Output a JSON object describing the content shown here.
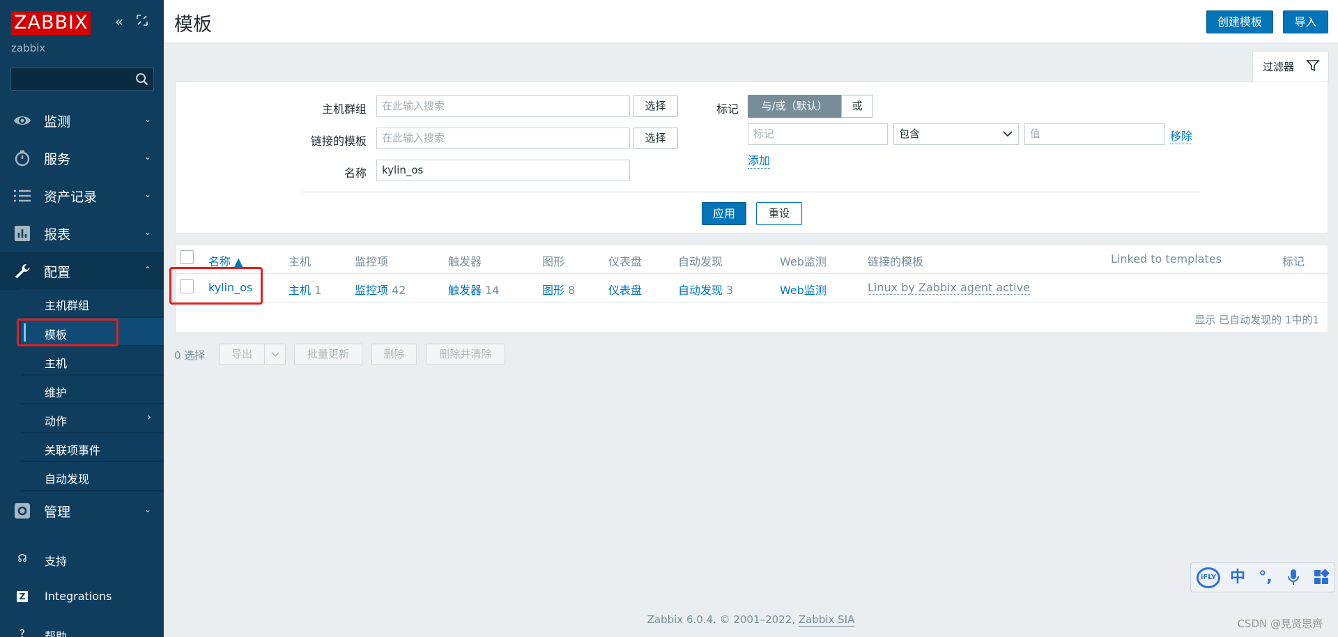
{
  "sidebar": {
    "logo": "ZABBIX",
    "server": "zabbix",
    "collapse_icon": "double-chevron-left-icon",
    "expand_icon": "kiosk-mode-icon",
    "search_placeholder": "",
    "menu": [
      {
        "label": "监测",
        "icon": "eye-icon"
      },
      {
        "label": "服务",
        "icon": "stopwatch-icon"
      },
      {
        "label": "资产记录",
        "icon": "list-icon"
      },
      {
        "label": "报表",
        "icon": "bar-chart-icon"
      },
      {
        "label": "配置",
        "icon": "wrench-icon"
      }
    ],
    "submenu": [
      {
        "label": "主机群组"
      },
      {
        "label": "模板"
      },
      {
        "label": "主机"
      },
      {
        "label": "维护"
      },
      {
        "label": "动作"
      },
      {
        "label": "关联项事件"
      },
      {
        "label": "自动发现"
      }
    ],
    "admin": {
      "label": "管理",
      "icon": "gear-icon"
    },
    "bottom": [
      {
        "label": "支持",
        "icon": "headset-icon"
      },
      {
        "label": "Integrations",
        "icon": "zabbix-z-icon"
      },
      {
        "label": "帮助",
        "icon": "question-icon"
      }
    ]
  },
  "header": {
    "title": "模板",
    "create_button": "创建模板",
    "import_button": "导入"
  },
  "filter": {
    "tab_label": "过滤器",
    "host_groups_label": "主机群组",
    "host_groups_placeholder": "在此输入搜索",
    "linked_templates_label": "链接的模板",
    "linked_templates_placeholder": "在此输入搜索",
    "select_button": "选择",
    "name_label": "名称",
    "name_value": "kylin_os",
    "tags_label": "标记",
    "tags_andor": "与/或（默认）",
    "tags_or": "或",
    "tag_placeholder": "标记",
    "tag_operator": "包含",
    "value_placeholder": "值",
    "remove_link": "移除",
    "add_link": "添加",
    "apply_button": "应用",
    "reset_button": "重设"
  },
  "table": {
    "columns": [
      "名称 ▲",
      "主机",
      "监控项",
      "触发器",
      "图形",
      "仪表盘",
      "自动发现",
      "Web监测",
      "链接的模板",
      "Linked to templates",
      "标记"
    ],
    "rows": [
      {
        "name": "kylin_os",
        "hosts_label": "主机",
        "hosts_count": "1",
        "items_label": "监控项",
        "items_count": "42",
        "triggers_label": "触发器",
        "triggers_count": "14",
        "graphs_label": "图形",
        "graphs_count": "8",
        "dashboards_label": "仪表盘",
        "discovery_label": "自动发现",
        "discovery_count": "3",
        "web_label": "Web监测",
        "linked_templates": "Linux by Zabbix agent active"
      }
    ],
    "footer_count": "显示 已自动发现的 1中的1"
  },
  "mass_actions": {
    "selected": "0 选择",
    "export": "导出",
    "mass_update": "批量更新",
    "delete": "删除",
    "delete_clear": "删除并清除"
  },
  "footer": {
    "text": "Zabbix 6.0.4. © 2001–2022,",
    "link": "Zabbix SIA"
  },
  "watermark": "CSDN @見贤思齊",
  "ime": {
    "brand": "iFLY",
    "mode": "中",
    "items": [
      "ifly-logo-icon",
      "chinese-mode-icon",
      "punctuation-icon",
      "microphone-icon",
      "apps-grid-icon"
    ]
  },
  "colors": {
    "sidebar_bg": "#0e3d5e",
    "logo_red": "#d40000",
    "primary_blue": "#0275b8",
    "highlight_red": "#e3201f"
  }
}
